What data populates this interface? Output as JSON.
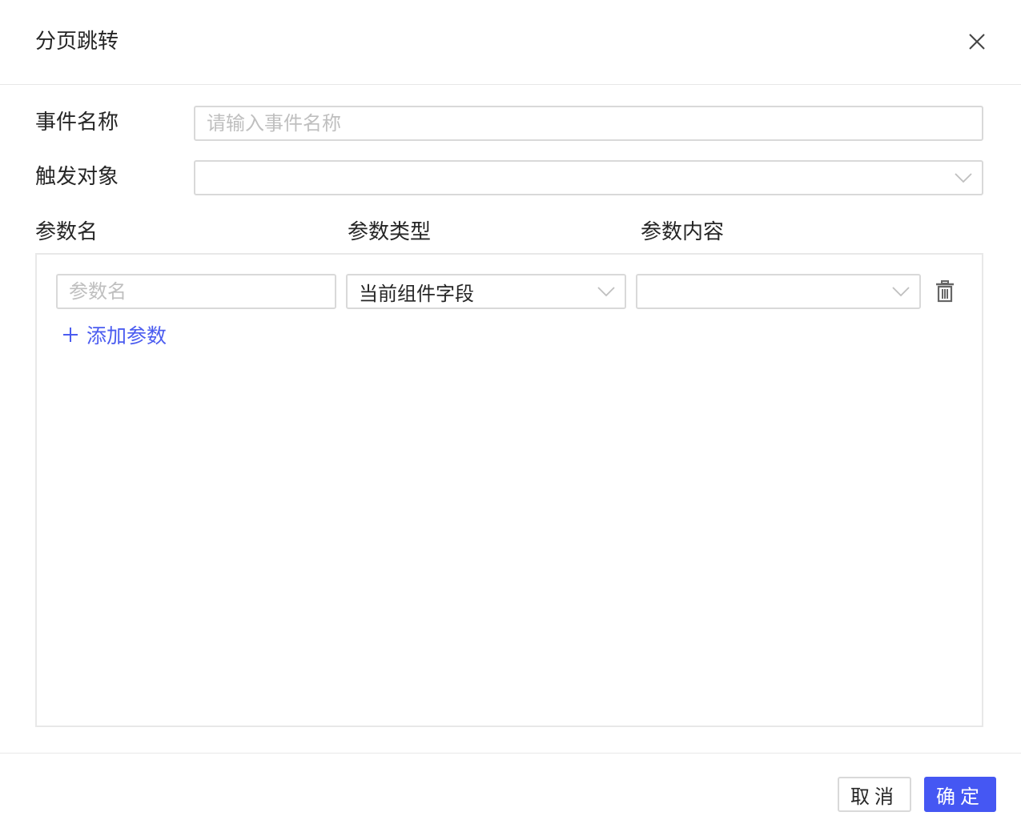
{
  "dialog": {
    "title": "分页跳转",
    "close_icon": "close-icon"
  },
  "form": {
    "event_name": {
      "label": "事件名称",
      "value": "",
      "placeholder": "请输入事件名称"
    },
    "trigger_target": {
      "label": "触发对象",
      "value": ""
    }
  },
  "params": {
    "columns": [
      "参数名",
      "参数类型",
      "参数内容"
    ],
    "rows": [
      {
        "name_value": "",
        "name_placeholder": "参数名",
        "type_value": "当前组件字段",
        "content_value": ""
      }
    ],
    "add_label": "添加参数"
  },
  "footer": {
    "cancel_label": "取消",
    "ok_label": "确定"
  },
  "colors": {
    "accent": "#4557f3",
    "link": "#4b5cf0",
    "border": "#d9d9d9",
    "placeholder": "#bfbfbf",
    "text": "#262626"
  }
}
